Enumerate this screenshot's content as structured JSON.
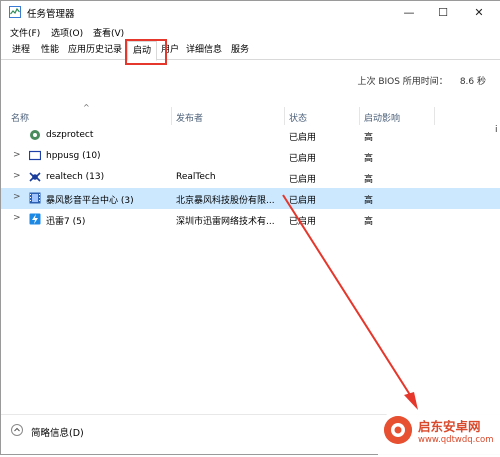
{
  "titlebar": {
    "title": "任务管理器",
    "minimize": "—",
    "maximize": "☐",
    "close": "✕"
  },
  "menu": [
    "文件(F)",
    "选项(O)",
    "查看(V)"
  ],
  "tabs": [
    "进程",
    "性能",
    "应用历史记录",
    "启动",
    "用户",
    "详细信息",
    "服务"
  ],
  "active_tab": "启动",
  "bios": {
    "label": "上次 BIOS 所用时间：",
    "value": "8.6 秒"
  },
  "columns": {
    "name": "名称",
    "publisher": "发布者",
    "status": "状态",
    "impact": "启动影响"
  },
  "rows": [
    {
      "name": "dszprotect",
      "publisher": "",
      "status": "已启用",
      "impact": "高",
      "expandable": false,
      "icon": "gear-icon"
    },
    {
      "name": "hppusg (10)",
      "publisher": "",
      "status": "已启用",
      "impact": "高",
      "expandable": true,
      "icon": "monitor-icon"
    },
    {
      "name": "realtech (13)",
      "publisher": "RealTech",
      "status": "已启用",
      "impact": "高",
      "expandable": true,
      "icon": "crab-icon"
    },
    {
      "name": "暴风影音平台中心 (3)",
      "publisher": "北京暴风科技股份有限...",
      "status": "已启用",
      "impact": "高",
      "expandable": true,
      "icon": "film-icon"
    },
    {
      "name": "迅雷7 (5)",
      "publisher": "深圳市迅雷网络技术有...",
      "status": "已启用",
      "impact": "高",
      "expandable": true,
      "icon": "thunder-icon"
    }
  ],
  "right_edge_char": "i",
  "footer": {
    "label": "简略信息(D)"
  },
  "watermark": {
    "text": "启东安卓网",
    "url": "www.qdtwdq.com"
  },
  "colors": {
    "selected_row": "#cce8ff",
    "highlight": "#e5372b",
    "header_text": "#4c607a"
  }
}
